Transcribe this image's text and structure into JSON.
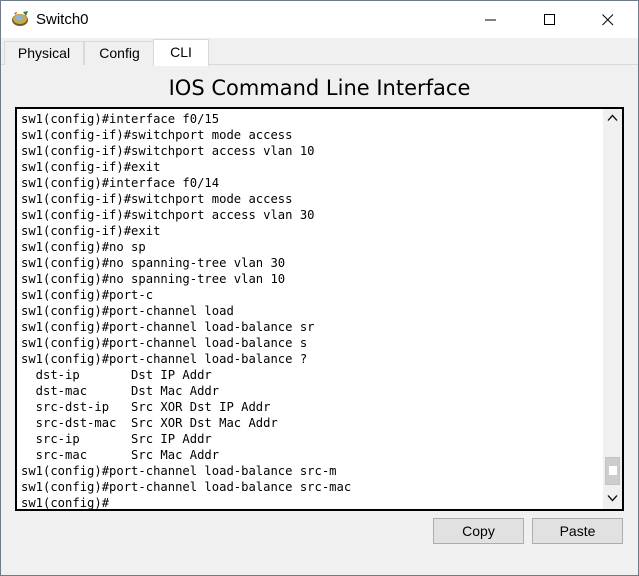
{
  "window": {
    "title": "Switch0"
  },
  "tabs": [
    {
      "label": "Physical"
    },
    {
      "label": "Config"
    },
    {
      "label": "CLI"
    }
  ],
  "heading": "IOS Command Line Interface",
  "console": {
    "lines": [
      "sw1(config)#interface f0/15",
      "sw1(config-if)#switchport mode access",
      "sw1(config-if)#switchport access vlan 10",
      "sw1(config-if)#exit",
      "sw1(config)#interface f0/14",
      "sw1(config-if)#switchport mode access",
      "sw1(config-if)#switchport access vlan 30",
      "sw1(config-if)#exit",
      "sw1(config)#no sp",
      "sw1(config)#no spanning-tree vlan 30",
      "sw1(config)#no spanning-tree vlan 10",
      "sw1(config)#port-c",
      "sw1(config)#port-channel load",
      "sw1(config)#port-channel load-balance sr",
      "sw1(config)#port-channel load-balance s",
      "sw1(config)#port-channel load-balance ?",
      "  dst-ip       Dst IP Addr",
      "  dst-mac      Dst Mac Addr",
      "  src-dst-ip   Src XOR Dst IP Addr",
      "  src-dst-mac  Src XOR Dst Mac Addr",
      "  src-ip       Src IP Addr",
      "  src-mac      Src Mac Addr",
      "sw1(config)#port-channel load-balance src-m",
      "sw1(config)#port-channel load-balance src-mac",
      "sw1(config)#"
    ]
  },
  "buttons": {
    "copy": "Copy",
    "paste": "Paste"
  }
}
